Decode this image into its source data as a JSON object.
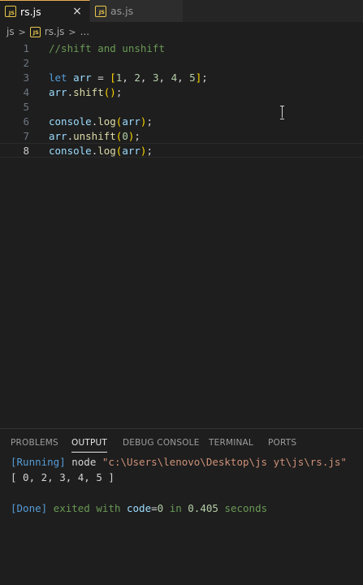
{
  "tabs": [
    {
      "label": "rs.js",
      "active": true,
      "close": "×",
      "icon": "JS"
    },
    {
      "label": "as.js",
      "active": false,
      "icon": "JS"
    }
  ],
  "breadcrumb": {
    "folder": "js",
    "file": "rs.js",
    "more": "..."
  },
  "editor": {
    "line_numbers": [
      "1",
      "2",
      "3",
      "4",
      "5",
      "6",
      "7",
      "8"
    ],
    "current_line": 8,
    "lines": {
      "l1": {
        "comment": "//shift and unshift"
      },
      "l3": {
        "kw": "let",
        "var": "arr",
        "eq": " = ",
        "open": "[",
        "n1": "1",
        "n2": "2",
        "n3": "3",
        "n4": "4",
        "n5": "5",
        "sep": ", ",
        "close": "]",
        "semi": ";"
      },
      "l4": {
        "var": "arr",
        "dot": ".",
        "fn": "shift",
        "open": "(",
        "close": ")",
        "semi": ";"
      },
      "l6": {
        "obj": "console",
        "dot": ".",
        "fn": "log",
        "open": "(",
        "arg": "arr",
        "close": ")",
        "semi": ";"
      },
      "l7": {
        "var": "arr",
        "dot": ".",
        "fn": "unshift",
        "open": "(",
        "arg": "0",
        "close": ")",
        "semi": ";"
      },
      "l8": {
        "obj": "console",
        "dot": ".",
        "fn": "log",
        "open": "(",
        "arg": "arr",
        "close": ")",
        "semi": ";"
      }
    }
  },
  "panel": {
    "tabs": [
      "PROBLEMS",
      "OUTPUT",
      "DEBUG CONSOLE",
      "TERMINAL",
      "PORTS"
    ],
    "active_tab": "OUTPUT",
    "output": {
      "running_tag": "[Running]",
      "running_cmd": " node ",
      "running_path": "\"c:\\Users\\lenovo\\Desktop\\js yt\\js\\rs.js\"",
      "result": "[ 0, 2, 3, 4, 5 ]",
      "done_tag": "[Done]",
      "done_text1": " exited with ",
      "done_code_key": "code",
      "done_eq": "=",
      "done_code_val": "0",
      "done_in": " in ",
      "done_time": "0.405",
      "done_seconds": " seconds"
    }
  },
  "colors": {
    "accent_tab": "#e8ab53",
    "js_icon": "#e8c64a"
  }
}
